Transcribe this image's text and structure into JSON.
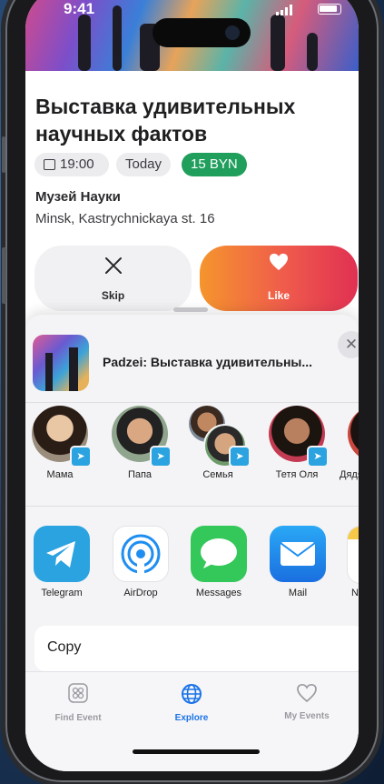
{
  "status_bar": {
    "time": "9:41"
  },
  "event": {
    "title": "Выставка удивительных научных фактов",
    "time": "19:00",
    "day": "Today",
    "price": "15 BYN",
    "venue": "Музей Науки",
    "address": "Minsk, Kastrychnickaya st. 16"
  },
  "actions": {
    "skip_label": "Skip",
    "like_label": "Like"
  },
  "share_sheet": {
    "title": "Padzei: Выставка удивительны...",
    "contacts": [
      {
        "name": "Мама"
      },
      {
        "name": "Папа"
      },
      {
        "name": "Семья"
      },
      {
        "name": "Тетя Оля"
      },
      {
        "name": "Дядя"
      }
    ],
    "apps": [
      {
        "name": "Telegram",
        "color": "#2aa3e0"
      },
      {
        "name": "AirDrop",
        "color": "#ffffff"
      },
      {
        "name": "Messages",
        "color": "#34c759"
      },
      {
        "name": "Mail",
        "color": "#1f8ef1"
      },
      {
        "name": "No"
      }
    ],
    "copy_label": "Copy"
  },
  "tab_bar": {
    "tabs": [
      {
        "label": "Find Event",
        "icon": "grid-icon"
      },
      {
        "label": "Explore",
        "icon": "globe-icon",
        "active": true
      },
      {
        "label": "My Events",
        "icon": "heart-icon"
      }
    ],
    "active_color": "#1a73e8"
  }
}
